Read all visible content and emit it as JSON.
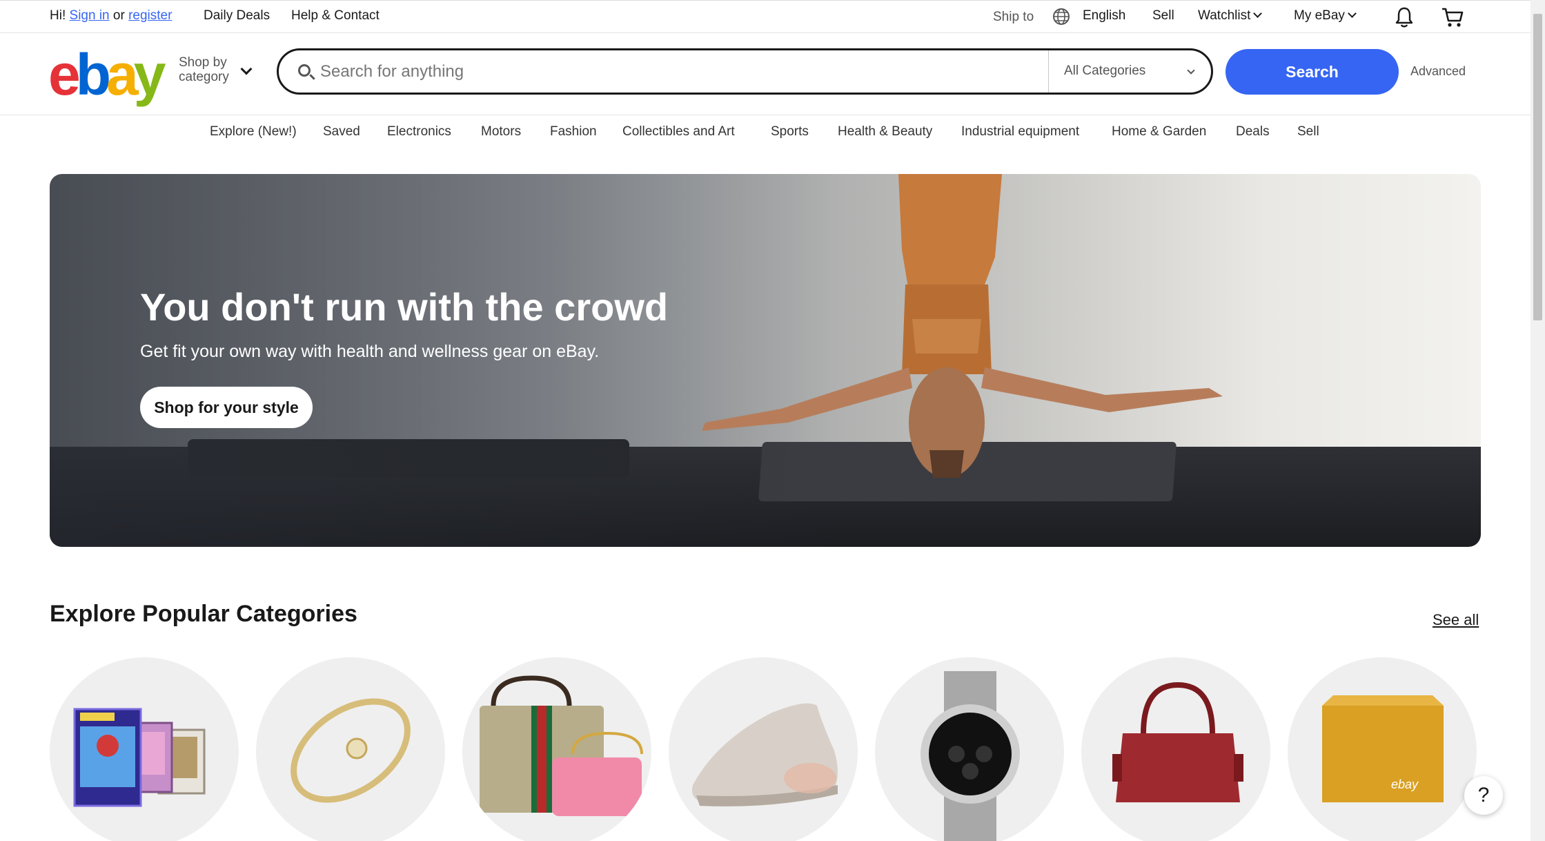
{
  "topbar": {
    "greeting": "Hi!",
    "sign_in": "Sign in",
    "or": "or",
    "register": "register",
    "daily_deals": "Daily Deals",
    "help_contact": "Help & Contact",
    "ship_to": "Ship to",
    "language": "English",
    "sell": "Sell",
    "watchlist": "Watchlist",
    "my_ebay": "My eBay"
  },
  "header": {
    "logo_letters": [
      "e",
      "b",
      "a",
      "y"
    ],
    "logo_colors": [
      "#e53238",
      "#0064d2",
      "#f5af02",
      "#86b817"
    ],
    "shop_by_line1": "Shop by",
    "shop_by_line2": "category",
    "search_placeholder": "Search for anything",
    "category_selected": "All Categories",
    "search_button": "Search",
    "advanced": "Advanced"
  },
  "nav": {
    "items": [
      "Explore (New!)",
      "Saved",
      "Electronics",
      "Motors",
      "Fashion",
      "Collectibles and Art",
      "Sports",
      "Health & Beauty",
      "Industrial equipment",
      "Home & Garden",
      "Deals",
      "Sell"
    ]
  },
  "hero": {
    "title": "You don't run with the crowd",
    "subtitle": "Get fit your own way with health and wellness gear on eBay.",
    "cta": "Shop for your style"
  },
  "categories": {
    "title": "Explore Popular Categories",
    "see_all": "See all",
    "box_brand": "ebay"
  },
  "help": {
    "label": "?"
  },
  "colors": {
    "accent": "#3665f3",
    "text": "#191919",
    "circle_bg": "#efefef"
  }
}
